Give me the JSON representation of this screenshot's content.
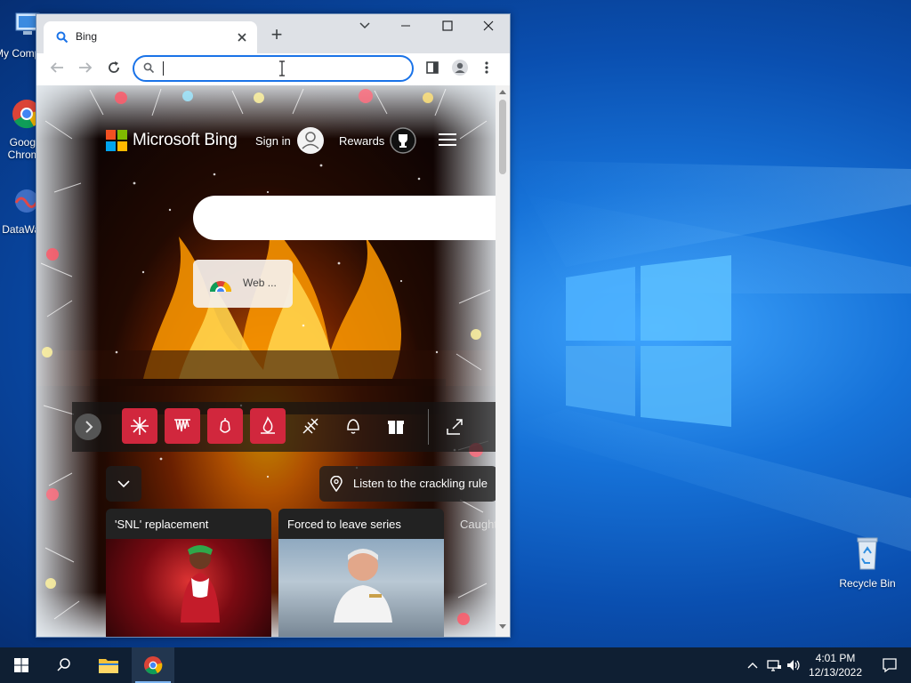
{
  "desktop": {
    "icons": [
      {
        "label": "My Computer"
      },
      {
        "label": "Google Chrome"
      },
      {
        "label": "DataWave"
      },
      {
        "label": "Recycle Bin"
      }
    ]
  },
  "browser": {
    "tab": {
      "title": "Bing",
      "icon": "search-icon"
    },
    "new_tab_label": "+",
    "omnibox": {
      "value": "",
      "placeholder": ""
    },
    "page": {
      "brand": "Microsoft Bing",
      "sign_in": "Sign in",
      "rewards": "Rewards",
      "web_tile_label": "Web ...",
      "location_text": "Listen to the crackling rule",
      "news": [
        {
          "title": "'SNL' replacement"
        },
        {
          "title": "Forced to leave series"
        },
        {
          "title": "Caught"
        }
      ],
      "carousel_icons": [
        "snowflake-icon",
        "icicles-icon",
        "ornament-icon",
        "fire-icon",
        "feather-icon",
        "bell-icon",
        "gift-icon"
      ]
    }
  },
  "taskbar": {
    "time": "4:01 PM",
    "date": "12/13/2022"
  },
  "colors": {
    "accent": "#1a73e8",
    "bing_red_tile": "#d1273d",
    "taskbar": "#0f1f33"
  }
}
